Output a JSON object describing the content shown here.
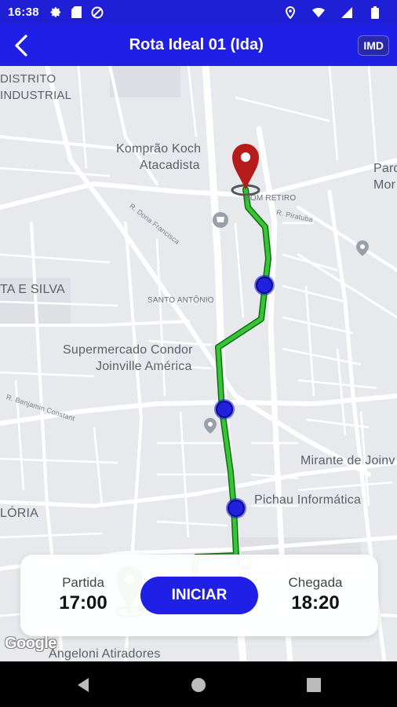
{
  "status_bar": {
    "time": "16:38",
    "icons": [
      "gear-icon",
      "sd-card-icon",
      "data-saver-icon",
      "location-icon",
      "wifi-icon",
      "battery-icon"
    ]
  },
  "app_bar": {
    "title": "Rota Ideal 01 (Ida)",
    "badge": "IMD",
    "color": "#1f1fe6"
  },
  "map": {
    "labels": {
      "distrito": "DISTRITO",
      "industrial": "INDUSTRIAL",
      "komprao_1": "Komprão Koch",
      "komprao_2": "Atacadista",
      "parq_1": "Parq",
      "parq_2": "Mor",
      "bom_retiro": "BOM RETIRO",
      "r_pirituba": "R. Piratuba",
      "r_dona_francisca": "R. Dona Francisca",
      "costa_e_silva": "TA E SILVA",
      "santo_antonio": "SANTO ANTÔNIO",
      "condor_1": "Supermercado Condor",
      "condor_2": "Joinville América",
      "r_benjamin": "R. Benjamin Constant",
      "mirante": "Mirante de Joinv",
      "pichau": "Pichau Informática",
      "gloria": "LÓRIA",
      "angeloni": "Angeloni Atiradores",
      "google": "Google"
    },
    "route_color": "#2fb32f",
    "origin_pin_color": "#2e7d32",
    "destination_pin_color": "#b71c1c",
    "stop_color": "#1f1fe6"
  },
  "card": {
    "departure_label": "Partida",
    "departure_time": "17:00",
    "start_button": "INICIAR",
    "arrival_label": "Chegada",
    "arrival_time": "18:20"
  }
}
